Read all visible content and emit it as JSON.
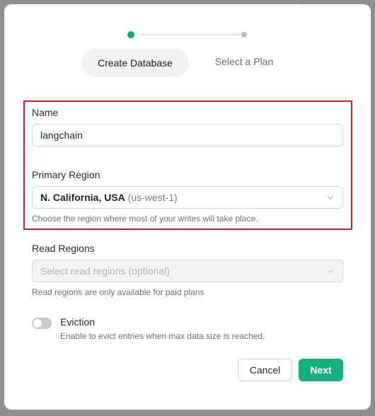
{
  "steps": {
    "active_label": "Create Database",
    "next_label": "Select a Plan"
  },
  "form": {
    "name": {
      "label": "Name",
      "value": "langchain"
    },
    "primary_region": {
      "label": "Primary Region",
      "selected_bold": "N. California, USA",
      "selected_code": "(us-west-1)",
      "help": "Choose the region where most of your writes will take place."
    },
    "read_regions": {
      "label": "Read Regions",
      "placeholder": "Select read regions (optional)",
      "help": "Read regions are only available for paid plans"
    },
    "eviction": {
      "label": "Eviction",
      "description": "Enable to evict entries when max data size is reached.",
      "enabled": false
    }
  },
  "actions": {
    "cancel_label": "Cancel",
    "next_label": "Next"
  },
  "colors": {
    "accent": "#16b07e",
    "highlight": "#d61d1d"
  },
  "icons": {
    "select_chevron": "chevron-down-icon"
  }
}
